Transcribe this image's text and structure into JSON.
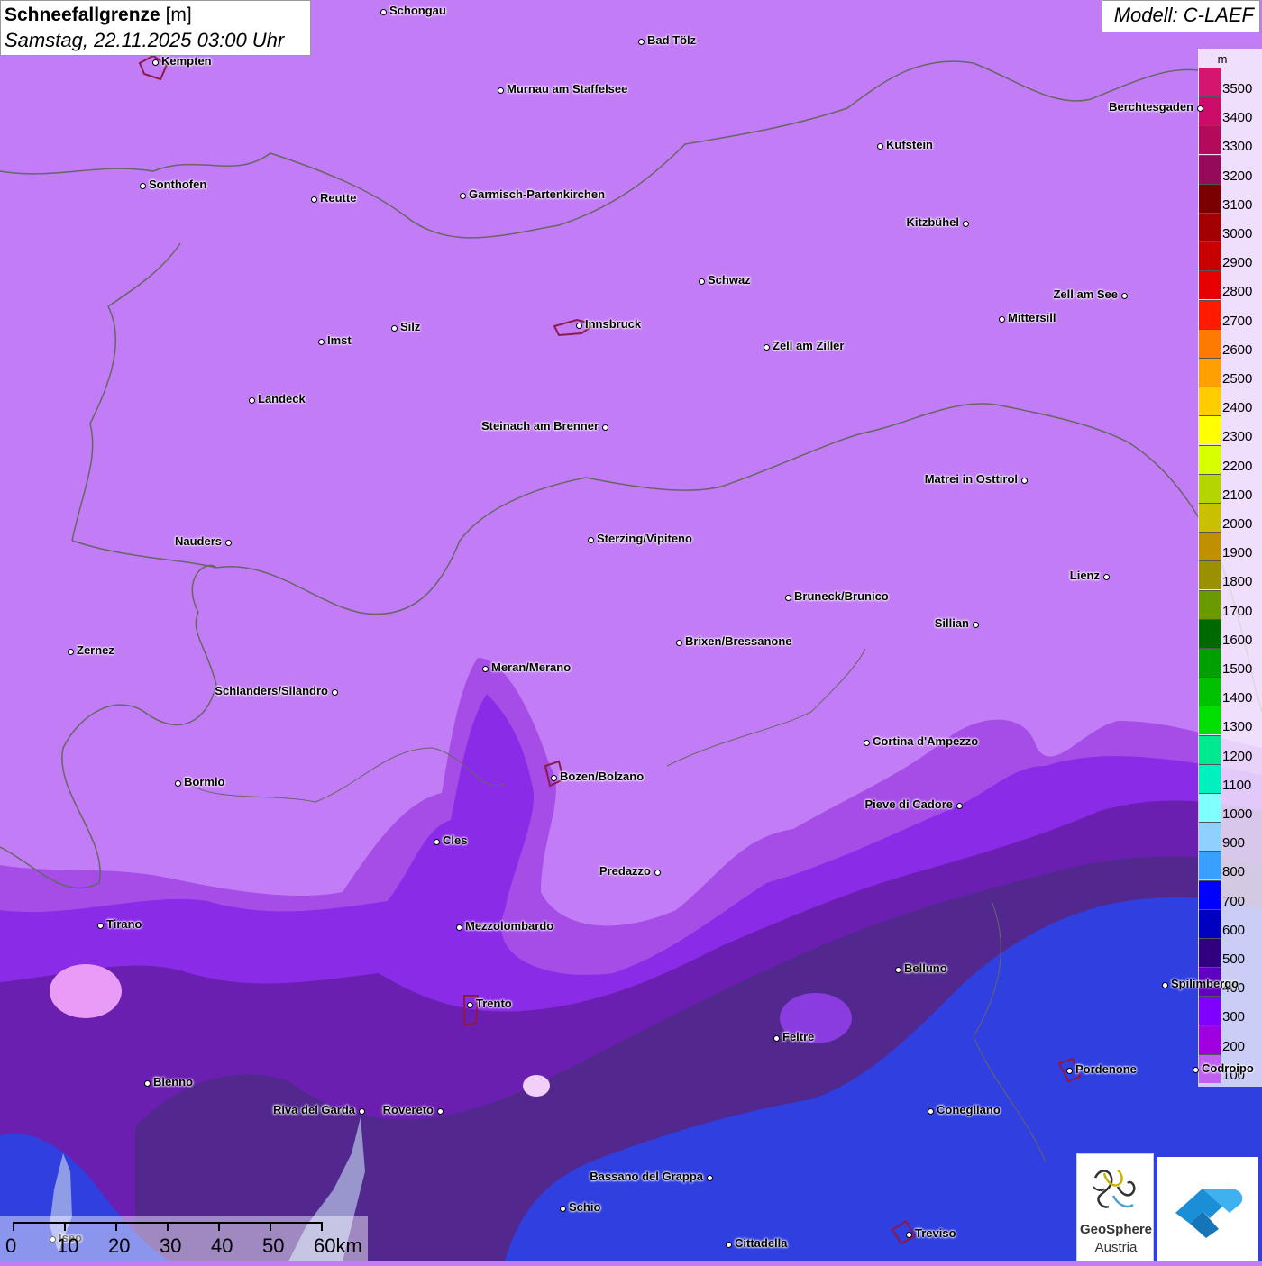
{
  "title": {
    "main": "Schneefallgrenze",
    "unit": "[m]",
    "date": "Samstag, 22.11.2025 03:00 Uhr"
  },
  "model": "Modell: C-LAEF",
  "legend": {
    "unit": "m",
    "classes": [
      {
        "label": "3500",
        "color": "#d6166e"
      },
      {
        "label": "3400",
        "color": "#cc0c68"
      },
      {
        "label": "3300",
        "color": "#b30a5c"
      },
      {
        "label": "3200",
        "color": "#950a59"
      },
      {
        "label": "3100",
        "color": "#7a0000"
      },
      {
        "label": "3000",
        "color": "#a30000"
      },
      {
        "label": "2900",
        "color": "#c80000"
      },
      {
        "label": "2800",
        "color": "#e60000"
      },
      {
        "label": "2700",
        "color": "#ff1a00"
      },
      {
        "label": "2600",
        "color": "#ff7a00"
      },
      {
        "label": "2500",
        "color": "#ffa000"
      },
      {
        "label": "2400",
        "color": "#ffcc00"
      },
      {
        "label": "2300",
        "color": "#ffff00"
      },
      {
        "label": "2200",
        "color": "#d6ff00"
      },
      {
        "label": "2100",
        "color": "#b4d600"
      },
      {
        "label": "2000",
        "color": "#c8c000"
      },
      {
        "label": "1900",
        "color": "#c09000"
      },
      {
        "label": "1800",
        "color": "#9a9000"
      },
      {
        "label": "1700",
        "color": "#6a9a00"
      },
      {
        "label": "1600",
        "color": "#006a00"
      },
      {
        "label": "1500",
        "color": "#00a000"
      },
      {
        "label": "1400",
        "color": "#00c000"
      },
      {
        "label": "1300",
        "color": "#00e000"
      },
      {
        "label": "1200",
        "color": "#00e890"
      },
      {
        "label": "1100",
        "color": "#00f0c0"
      },
      {
        "label": "1000",
        "color": "#80ffff"
      },
      {
        "label": "900",
        "color": "#90d0ff"
      },
      {
        "label": "800",
        "color": "#3aa0ff"
      },
      {
        "label": "700",
        "color": "#0000ff"
      },
      {
        "label": "600",
        "color": "#0000c0"
      },
      {
        "label": "500",
        "color": "#300080"
      },
      {
        "label": "400",
        "color": "#6000c0"
      },
      {
        "label": "300",
        "color": "#8000ff"
      },
      {
        "label": "200",
        "color": "#a000e0"
      },
      {
        "label": "100",
        "color": "#c060f0"
      }
    ]
  },
  "cities": [
    {
      "name": "Schongau",
      "side": "right"
    },
    {
      "name": "Bad Tölz",
      "side": "right"
    },
    {
      "name": "Kempten",
      "side": "right"
    },
    {
      "name": "Murnau am Staffelsee",
      "side": "right"
    },
    {
      "name": "Berchtesgaden",
      "side": "left"
    },
    {
      "name": "Kufstein",
      "side": "right"
    },
    {
      "name": "Sonthofen",
      "side": "right"
    },
    {
      "name": "Reutte",
      "side": "right"
    },
    {
      "name": "Garmisch-Partenkirchen",
      "side": "right"
    },
    {
      "name": "Kitzbühel",
      "side": "left"
    },
    {
      "name": "Schwaz",
      "side": "right"
    },
    {
      "name": "Zell am See",
      "side": "left"
    },
    {
      "name": "Mittersill",
      "side": "right"
    },
    {
      "name": "Innsbruck",
      "side": "right"
    },
    {
      "name": "Imst",
      "side": "right"
    },
    {
      "name": "Silz",
      "side": "right"
    },
    {
      "name": "Zell am Ziller",
      "side": "right"
    },
    {
      "name": "Landeck",
      "side": "right"
    },
    {
      "name": "Steinach am Brenner",
      "side": "left"
    },
    {
      "name": "Matrei in Osttirol",
      "side": "left"
    },
    {
      "name": "Nauders",
      "side": "left"
    },
    {
      "name": "Sterzing/Vipiteno",
      "side": "right"
    },
    {
      "name": "Lienz",
      "side": "left"
    },
    {
      "name": "Bruneck/Brunico",
      "side": "right"
    },
    {
      "name": "Sillian",
      "side": "left"
    },
    {
      "name": "Zernez",
      "side": "right"
    },
    {
      "name": "Brixen/Bressanone",
      "side": "right"
    },
    {
      "name": "Meran/Merano",
      "side": "right"
    },
    {
      "name": "Schlanders/Silandro",
      "side": "left"
    },
    {
      "name": "Cortina d'Ampezzo",
      "side": "right"
    },
    {
      "name": "Bozen/Bolzano",
      "side": "right"
    },
    {
      "name": "Bormio",
      "side": "right"
    },
    {
      "name": "Pieve di Cadore",
      "side": "left"
    },
    {
      "name": "Cles",
      "side": "right"
    },
    {
      "name": "Predazzo",
      "side": "left"
    },
    {
      "name": "Tirano",
      "side": "right"
    },
    {
      "name": "Mezzolombardo",
      "side": "right"
    },
    {
      "name": "Belluno",
      "side": "right"
    },
    {
      "name": "Spilimbergo",
      "side": "right"
    },
    {
      "name": "Trento",
      "side": "right"
    },
    {
      "name": "Feltre",
      "side": "right"
    },
    {
      "name": "Pordenone",
      "side": "right"
    },
    {
      "name": "Codroipo",
      "side": "right"
    },
    {
      "name": "Bienno",
      "side": "right"
    },
    {
      "name": "Riva del Garda",
      "side": "left"
    },
    {
      "name": "Rovereto",
      "side": "left"
    },
    {
      "name": "Conegliano",
      "side": "right"
    },
    {
      "name": "Bassano del Grappa",
      "side": "left"
    },
    {
      "name": "Schio",
      "side": "right"
    },
    {
      "name": "Treviso",
      "side": "right"
    },
    {
      "name": "Cittadella",
      "side": "right"
    },
    {
      "name": "Iseo",
      "side": "right"
    }
  ],
  "scale": {
    "labels": [
      "0",
      "10",
      "20",
      "30",
      "40",
      "50",
      "60km"
    ]
  },
  "logos": {
    "geosphere_line1": "GeoSphere",
    "geosphere_line2": "Austria"
  }
}
